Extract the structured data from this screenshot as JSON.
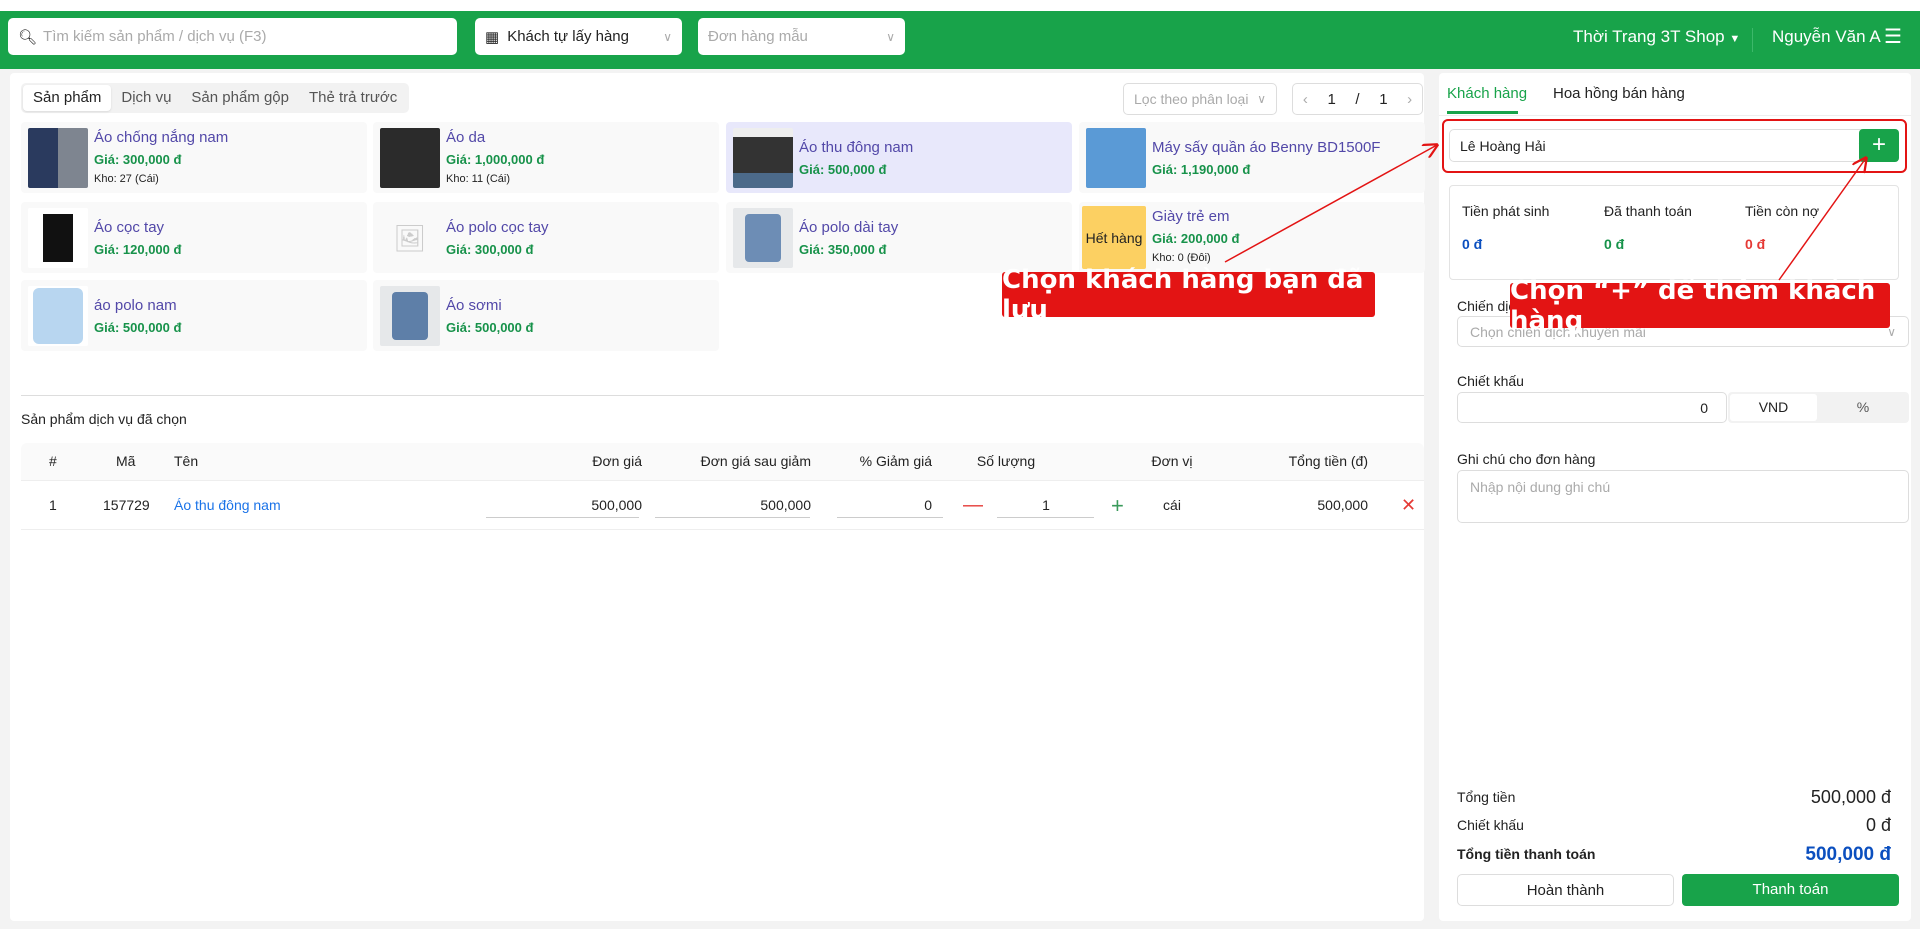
{
  "header": {
    "search_placeholder": "Tìm kiếm sản phẩm / dịch vụ (F3)",
    "delivery": "Khách tự lấy hàng",
    "template_placeholder": "Đơn hàng mẫu",
    "shop": "Thời Trang 3T Shop",
    "user": "Nguyễn Văn A"
  },
  "tabs": [
    "Sản phẩm",
    "Dịch vụ",
    "Sản phẩm gộp",
    "Thẻ trả trước"
  ],
  "filter_placeholder": "Lọc theo phân loại",
  "pager": {
    "current": "1",
    "sep": "/",
    "total": "1"
  },
  "products": [
    {
      "name": "Áo chống nắng nam",
      "price": "Giá: 300,000 đ",
      "stock": "Kho: 27 (Cái)"
    },
    {
      "name": "Áo da",
      "price": "Giá: 1,000,000 đ",
      "stock": "Kho: 11 (Cái)"
    },
    {
      "name": "Áo thu đông nam",
      "price": "Giá: 500,000 đ"
    },
    {
      "name": "Máy sấy quần áo Benny BD1500F",
      "price": "Giá: 1,190,000 đ"
    },
    {
      "name": "Áo cọc tay",
      "price": "Giá: 120,000 đ"
    },
    {
      "name": "Áo polo cọc tay",
      "price": "Giá: 300,000 đ"
    },
    {
      "name": "Áo polo dài tay",
      "price": "Giá: 350,000 đ"
    },
    {
      "name": "Giày trẻ em",
      "price": "Giá: 200,000 đ",
      "stock": "Kho: 0 (Đôi)",
      "badge": "Hết hàng"
    },
    {
      "name": "áo polo nam",
      "price": "Giá: 500,000 đ"
    },
    {
      "name": "Áo sơmi",
      "price": "Giá: 500,000 đ"
    }
  ],
  "selected": {
    "title": "Sản phẩm dịch vụ đã chọn",
    "columns": [
      "#",
      "Mã",
      "Tên",
      "Đơn giá",
      "Đơn giá sau giảm",
      "% Giảm giá",
      "Số lượng",
      "Đơn vị",
      "Tổng tiền (đ)"
    ],
    "rows": [
      {
        "no": "1",
        "code": "157729",
        "name": "Áo thu đông nam",
        "price": "500,000",
        "price_after": "500,000",
        "discount": "0",
        "qty": "1",
        "unit": "cái",
        "total": "500,000"
      }
    ]
  },
  "right": {
    "tabs": [
      "Khách hàng",
      "Hoa hồng bán hàng"
    ],
    "customer": "Lê Hoàng Hải",
    "summary": {
      "labels": [
        "Tiền phát sinh",
        "Đã thanh toán",
        "Tiền còn nợ"
      ],
      "values": [
        "0 đ",
        "0 đ",
        "0 đ"
      ]
    },
    "campaign_label": "Chiến dịch khuyến mãi",
    "campaign_placeholder": "Chọn chiến dịch khuyến mãi",
    "discount_label": "Chiết khấu",
    "discount_value": "0",
    "discount_units": [
      "VND",
      "%"
    ],
    "note_label": "Ghi chú cho đơn hàng",
    "note_placeholder": "Nhập nội dung ghi chú",
    "totals": {
      "total_label": "Tổng tiền",
      "total": "500,000 đ",
      "discount_label": "Chiết khấu",
      "discount": "0 đ",
      "pay_label": "Tổng tiền thanh toán",
      "pay": "500,000 đ"
    },
    "buttons": {
      "complete": "Hoàn thành",
      "pay": "Thanh toán"
    }
  },
  "annotations": [
    "Chọn khách hàng bạn đã lưu",
    "Chọn “+” để thêm khách hàng"
  ],
  "colors": {
    "brand": "#18a34a",
    "annotation": "#e31414",
    "link": "#1a73e8",
    "total": "#0b4fbf"
  }
}
